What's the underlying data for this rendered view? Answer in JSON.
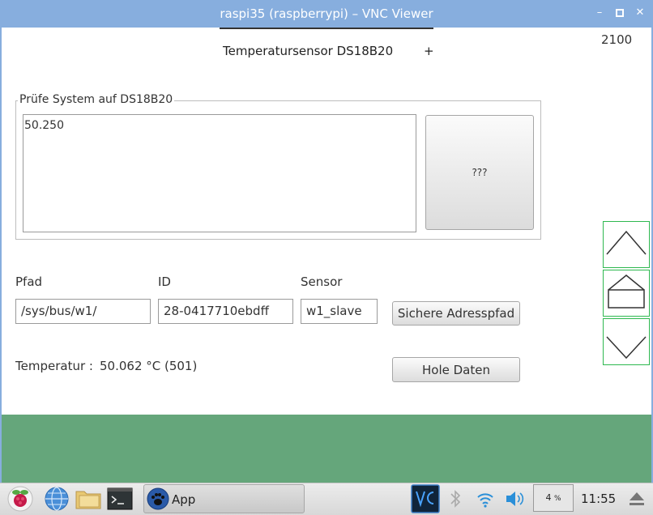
{
  "window": {
    "title": "raspi35 (raspberrypi) – VNC Viewer"
  },
  "header": {
    "label": "Temperatursensor DS18B20",
    "plus": "+",
    "counter": "2100"
  },
  "group": {
    "title": "Prüfe System auf DS18B20",
    "output_value": "50.250",
    "button_label": "???"
  },
  "fields": {
    "path_label": "Pfad",
    "path_value": "/sys/bus/w1/",
    "id_label": "ID",
    "id_value": "28-0417710ebdff",
    "sensor_label": "Sensor",
    "sensor_value": "w1_slave"
  },
  "buttons": {
    "save_path": "Sichere Adresspfad",
    "fetch_data": "Hole Daten"
  },
  "temperature": {
    "label": "Temperatur :",
    "value": "50.062 °C (501)"
  },
  "taskbar": {
    "app_label": "App",
    "cpu_value": "4",
    "cpu_unit": "%",
    "clock": "11:55"
  },
  "colors": {
    "titlebar": "#87aede",
    "green_panel": "#65a67b",
    "nav_border": "#2eb84f"
  }
}
